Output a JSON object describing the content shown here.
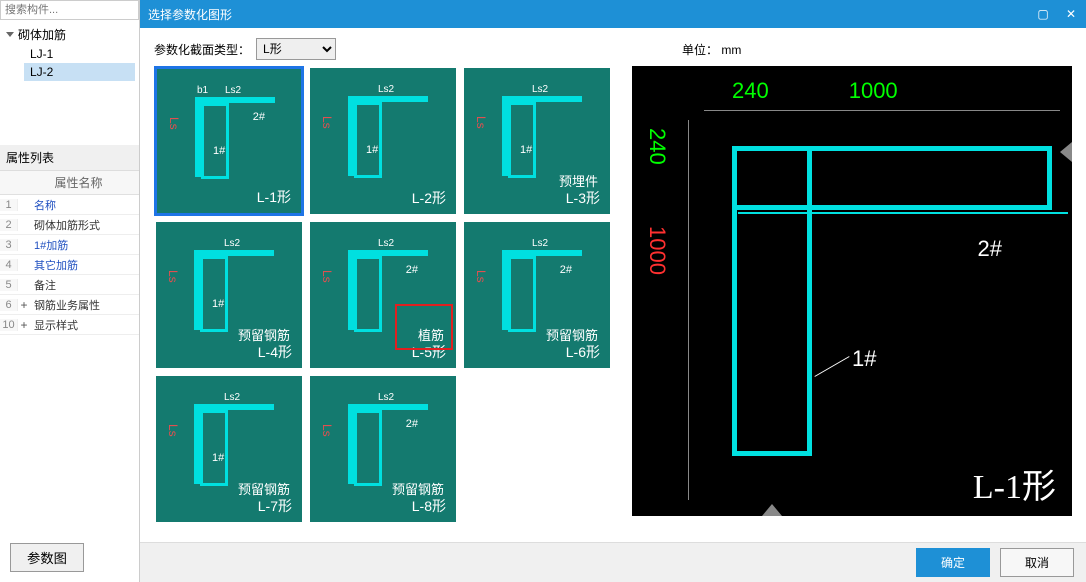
{
  "search": {
    "placeholder": "搜索构件..."
  },
  "tree": {
    "root": "砌体加筋",
    "items": [
      "LJ-1",
      "LJ-2"
    ],
    "selected_index": 1
  },
  "props": {
    "title": "属性列表",
    "header": "属性名称",
    "rows": [
      {
        "idx": "1",
        "label": "名称",
        "link": true
      },
      {
        "idx": "2",
        "label": "砌体加筋形式"
      },
      {
        "idx": "3",
        "label": "1#加筋",
        "link": true
      },
      {
        "idx": "4",
        "label": "其它加筋",
        "link": true
      },
      {
        "idx": "5",
        "label": "备注"
      },
      {
        "idx": "6",
        "label": "钢筋业务属性",
        "expand": "+"
      },
      {
        "idx": "10",
        "label": "显示样式",
        "expand": "+"
      }
    ]
  },
  "param_button": "参数图",
  "dialog": {
    "title": "选择参数化图形",
    "section_label": "参数化截面类型：",
    "section_value": "L形",
    "unit_label": "单位：",
    "unit_value": "mm",
    "shapes": [
      {
        "name": "L-1形",
        "extra": ""
      },
      {
        "name": "L-2形",
        "extra": ""
      },
      {
        "name": "L-3形",
        "extra": "预埋件"
      },
      {
        "name": "L-4形",
        "extra": "预留钢筋"
      },
      {
        "name": "L-5形",
        "extra": "植筋"
      },
      {
        "name": "L-6形",
        "extra": "预留钢筋"
      },
      {
        "name": "L-7形",
        "extra": "预留钢筋"
      },
      {
        "name": "L-8形",
        "extra": "预留钢筋"
      }
    ],
    "selected_shape": 0,
    "marked_shape": 4,
    "thumb_labels": {
      "ls2": "Ls2",
      "b1": "b1",
      "ls": "Ls",
      "one": "1#",
      "two": "2#"
    },
    "preview": {
      "dim_240": "240",
      "dim_1000": "1000",
      "label_1": "1#",
      "label_2": "2#",
      "type_label": "L-1形"
    },
    "ok": "确定",
    "cancel": "取消"
  }
}
